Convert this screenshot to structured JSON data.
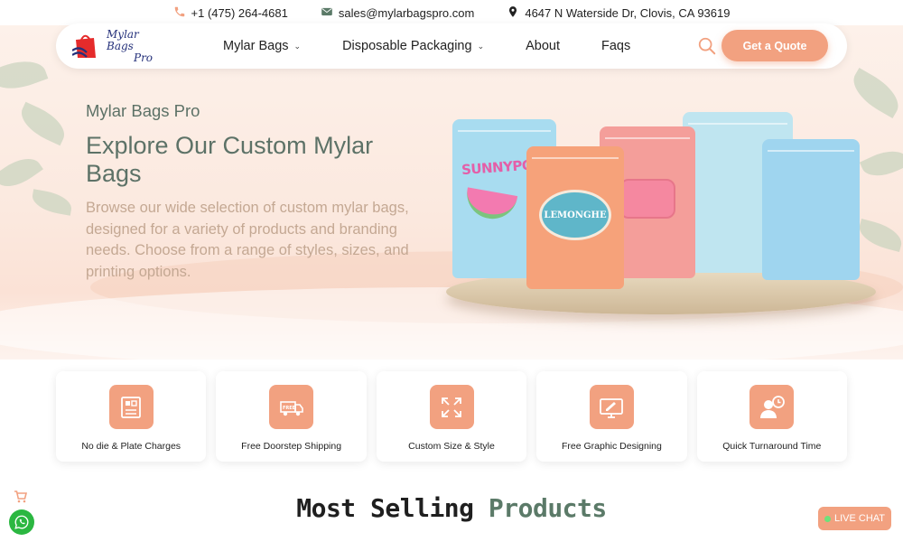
{
  "contact": {
    "phone": "+1 (475) 264-4681",
    "email": "sales@mylarbagspro.com",
    "address": "4647 N Waterside Dr, Clovis, CA 93619"
  },
  "logo": {
    "line1": "Mylar Bags",
    "line2": "Pro"
  },
  "nav": {
    "items": [
      {
        "label": "Mylar Bags",
        "dropdown": true
      },
      {
        "label": "Disposable Packaging",
        "dropdown": true
      },
      {
        "label": "About",
        "dropdown": false
      },
      {
        "label": "Faqs",
        "dropdown": false
      }
    ],
    "cta": "Get a Quote"
  },
  "hero": {
    "eyebrow": "Mylar Bags Pro",
    "title": "Explore Our Custom Mylar Bags",
    "description": "Browse our wide selection of custom mylar bags, designed for a variety of products and branding needs. Choose from a range of styles, sizes, and printing options.",
    "bag_labels": [
      "SUNNYPOP",
      "LEMONGHE"
    ]
  },
  "features": [
    {
      "label": "No die & Plate Charges",
      "icon": "plate-icon"
    },
    {
      "label": "Free Doorstep Shipping",
      "icon": "free-truck-icon"
    },
    {
      "label": "Custom Size & Style",
      "icon": "resize-arrows-icon"
    },
    {
      "label": "Free Graphic Designing",
      "icon": "design-monitor-icon"
    },
    {
      "label": "Quick Turnaround Time",
      "icon": "user-clock-icon"
    }
  ],
  "section": {
    "title_dark": "Most Selling",
    "title_accent": "Products"
  },
  "live_chat": "LIVE CHAT",
  "colors": {
    "accent": "#f2a180",
    "green_text": "#5d7267",
    "desc_text": "#c4a893",
    "whatsapp": "#2bb741"
  }
}
